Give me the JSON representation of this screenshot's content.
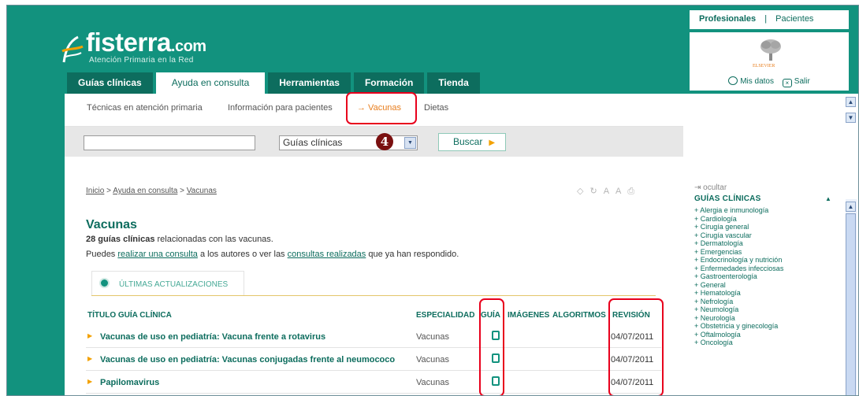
{
  "header": {
    "logo_name": "fisterra",
    "logo_tld": ".com",
    "tagline": "Atención Primaria en la Red"
  },
  "top_links": {
    "professionals": "Profesionales",
    "separator": "|",
    "patients": "Pacientes"
  },
  "publisher": {
    "name": "ELSEVIER"
  },
  "user_links": {
    "my_data": "Mis datos",
    "logout": "Salir"
  },
  "main_tabs": [
    {
      "label": "Guías clínicas"
    },
    {
      "label": "Ayuda en consulta"
    },
    {
      "label": "Herramientas"
    },
    {
      "label": "Formación"
    },
    {
      "label": "Tienda"
    }
  ],
  "sub_nav": [
    {
      "label": "Técnicas en atención primaria"
    },
    {
      "label": "Información para pacientes"
    },
    {
      "label": "→ Vacunas"
    },
    {
      "label": "Dietas"
    }
  ],
  "search": {
    "value": "",
    "select_value": "Guías clínicas",
    "button_label": "Buscar",
    "step_number": "4"
  },
  "breadcrumb": {
    "home": "Inicio",
    "sep": " > ",
    "section": "Ayuda en consulta",
    "current": "Vacunas"
  },
  "page": {
    "title": "Vacunas",
    "count_bold": "28 guías clínicas",
    "count_rest": " relacionadas con las vacunas.",
    "consult_pre": "Puedes ",
    "consult_link1": "realizar una consulta",
    "consult_mid": " a los autores o ver las ",
    "consult_link2": "consultas realizadas",
    "consult_post": " que ya han respondido."
  },
  "updates_tab": {
    "label": "ÚLTIMAS ACTUALIZACIONES"
  },
  "table": {
    "headers": {
      "title": "TÍTULO GUÍA CLÍNICA",
      "specialty": "ESPECIALIDAD",
      "guide": "GUÍA",
      "images": "IMÁGENES",
      "algorithms": "ALGORITMOS",
      "revision": "REVISIÓN"
    },
    "rows": [
      {
        "title": "Vacunas de uso en pediatría: Vacuna frente a rotavirus",
        "specialty": "Vacunas",
        "revision": "04/07/2011"
      },
      {
        "title": "Vacunas de uso en pediatría: Vacunas conjugadas frente al neumococo",
        "specialty": "Vacunas",
        "revision": "04/07/2011"
      },
      {
        "title": "Papilomavirus",
        "specialty": "Vacunas",
        "revision": "04/07/2011"
      }
    ]
  },
  "sidebar": {
    "hide_label": "ocultar",
    "title": "GUÍAS CLÍNICAS",
    "items": [
      "+ Alergia e inmunología",
      "+ Cardiología",
      "+ Cirugía general",
      "+ Cirugía vascular",
      "+ Dermatología",
      "+ Emergencias",
      "+ Endocrinología y nutrición",
      "+ Enfermedades infecciosas",
      "+ Gastroenterología",
      "+ General",
      "+ Hematología",
      "+ Nefrología",
      "+ Neumología",
      "+ Neurología",
      "+ Obstetricia y ginecología",
      "+ Oftalmología",
      "+ Oncología"
    ]
  },
  "colors": {
    "brand_teal": "#12927e",
    "dark_teal": "#0d6d5e",
    "accent_orange": "#e87e1e",
    "highlight_red": "#e8001c"
  }
}
